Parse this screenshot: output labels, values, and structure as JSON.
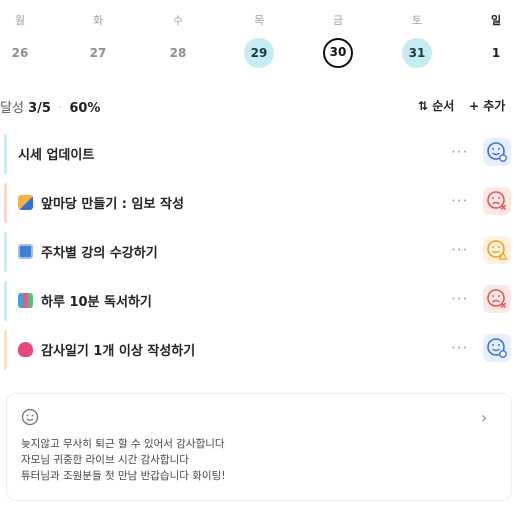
{
  "week": {
    "days": [
      {
        "dow": "월",
        "date": "26",
        "state": "normal"
      },
      {
        "dow": "화",
        "date": "27",
        "state": "normal"
      },
      {
        "dow": "수",
        "date": "28",
        "state": "normal"
      },
      {
        "dow": "목",
        "date": "29",
        "state": "marked"
      },
      {
        "dow": "금",
        "date": "30",
        "state": "today"
      },
      {
        "dow": "토",
        "date": "31",
        "state": "marked"
      },
      {
        "dow": "일",
        "date": "1",
        "state": "sunday"
      }
    ]
  },
  "summary": {
    "achieve_label": "달성",
    "achieve_count": "3/5",
    "separator": "·",
    "achieve_percent": "60%",
    "order_label": "⇅ 순서",
    "add_label": "+ 추가"
  },
  "tasks": [
    {
      "emoji": "",
      "label": "시세 업데이트",
      "bar_color": "#c6ecf3",
      "status": "done",
      "status_color": "#3d6fd8",
      "status_bg": "#e6efff"
    },
    {
      "emoji": "writing-hand-emoji",
      "label": "앞마당 만들기 : 임보 작성",
      "bar_color": "#ffd7c9",
      "status": "fail",
      "status_color": "#e05555",
      "status_bg": "#fde8e8"
    },
    {
      "emoji": "laptop-emoji",
      "label": "주차별 강의 수강하기",
      "bar_color": "#c6ecf3",
      "status": "warn",
      "status_color": "#f0a020",
      "status_bg": "#fff1dc"
    },
    {
      "emoji": "books-emoji",
      "label": "하루 10분 독서하기",
      "bar_color": "#c6ecf3",
      "status": "fail",
      "status_color": "#e05555",
      "status_bg": "#fde8e8"
    },
    {
      "emoji": "heart-emoji",
      "label": "감사일기 1개 이상 작성하기",
      "bar_color": "#ffe3b5",
      "status": "done",
      "status_color": "#3d6fd8",
      "status_bg": "#e6efff"
    }
  ],
  "more_label": "···",
  "memo": {
    "face_icon": "smile-face-icon",
    "chevron": "›",
    "lines": [
      "늦지않고 무사히 퇴근 할 수 있어서 감사합니다",
      "자모님 귀중한 라이브 시간 감사합니다",
      "튜터님과 조원분들 첫 만남 반갑습니다 화이팅!"
    ]
  }
}
